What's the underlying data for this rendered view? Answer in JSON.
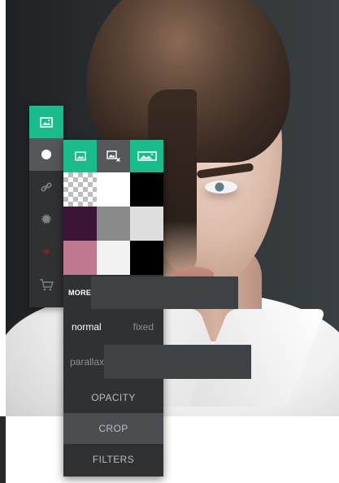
{
  "colors": {
    "accent": "#1bbc8b",
    "panel_bg": "#2f3133",
    "active_tab": "#55585b",
    "sidebar_icon_danger": "#b0222c"
  },
  "sidebar": {
    "items": [
      {
        "icon": "image-icon",
        "state": "active"
      },
      {
        "icon": "circle-icon",
        "state": "selected"
      },
      {
        "icon": "link-icon",
        "state": "normal"
      },
      {
        "icon": "gear-icon",
        "state": "normal"
      },
      {
        "icon": "heart-icon",
        "state": "normal"
      },
      {
        "icon": "cart-icon",
        "state": "normal"
      }
    ]
  },
  "panel": {
    "tabs": [
      {
        "icon": "image-icon",
        "state": "active"
      },
      {
        "icon": "remove-image-icon",
        "state": "normal"
      },
      {
        "icon": "wide-image-icon",
        "state": "active"
      }
    ],
    "swatches": [
      "transparent",
      "#ffffff",
      "#000000",
      "#3b1536",
      "#8a8a8a",
      "#dedede",
      "#c07890",
      "#f2f2f2",
      "#000000"
    ],
    "more_label": "MORE",
    "more_value": "",
    "attachment": {
      "normal_label": "normal",
      "fixed_label": "fixed",
      "selected": "normal"
    },
    "parallax_label": "parallax",
    "parallax_value": "",
    "actions": {
      "opacity": "OPACITY",
      "crop": "CROP",
      "filters": "FILTERS"
    }
  }
}
